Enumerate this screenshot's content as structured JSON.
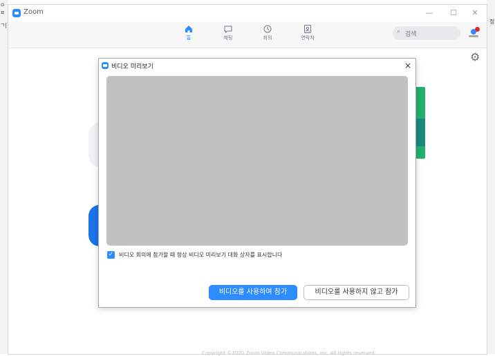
{
  "background": {
    "left_fragments": [
      "ㅇㅍ",
      "ㄱ|"
    ],
    "right_fragment": "정"
  },
  "window": {
    "title": "Zoom",
    "controls": {
      "minimize": "—",
      "maximize": "☐",
      "close": "✕"
    }
  },
  "toolbar": {
    "tabs": [
      {
        "label": "홈",
        "icon": "home-icon",
        "active": true
      },
      {
        "label": "채팅",
        "icon": "chat-icon",
        "active": false
      },
      {
        "label": "회의",
        "icon": "clock-icon",
        "active": false
      },
      {
        "label": "연락처",
        "icon": "contact-icon",
        "active": false
      }
    ],
    "search_placeholder": "검색",
    "avatar": "avatar-icon"
  },
  "settings_icon": "⚙",
  "footer": {
    "copyright": "Copyright ©2020 Zoom Video Communications, Inc. All rights reserved."
  },
  "dialog": {
    "title": "비디오 미리보기",
    "close": "×",
    "checkbox": {
      "checked": true,
      "label": "비디오 회의에 참가할 때 항상 비디오 미리보기 대화 상자를 표시합니다"
    },
    "primary_button": "비디오를 사용하여 참가",
    "secondary_button": "비디오를 사용하지 않고 참가"
  },
  "colors": {
    "accent": "#2d8cff",
    "preview_gray": "#c1c1c1",
    "deco_green": "#23b06d"
  }
}
